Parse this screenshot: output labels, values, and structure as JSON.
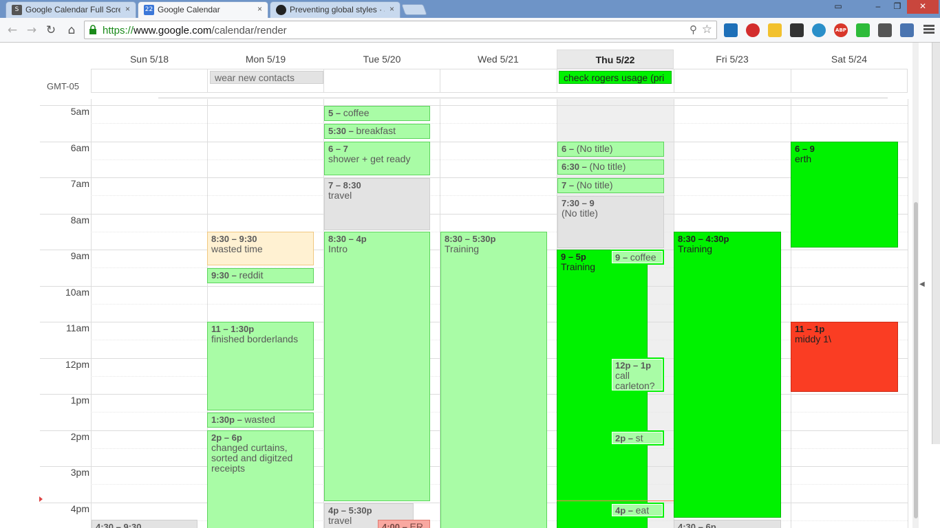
{
  "browser": {
    "tabs": [
      {
        "title": "Google Calendar Full Scre",
        "icon": "s-icon",
        "active": false
      },
      {
        "title": "Google Calendar",
        "icon": "calendar-icon",
        "active": true
      },
      {
        "title": "Preventing global styles · J",
        "icon": "github-icon",
        "active": false
      }
    ],
    "tab_close": "×",
    "calendar_favicon_text": "22",
    "url": {
      "scheme": "https://",
      "domain": "www.google.com",
      "path": "/calendar/render"
    },
    "extensions": [
      "ABP"
    ]
  },
  "calendar": {
    "timezone": "GMT-05",
    "days": [
      "Sun 5/18",
      "Mon 5/19",
      "Tue 5/20",
      "Wed 5/21",
      "Thu 5/22",
      "Fri 5/23",
      "Sat 5/24"
    ],
    "today_index": 4,
    "allday_events": [
      {
        "day": 1,
        "title": "wear new contacts",
        "style": "gray"
      },
      {
        "day": 4,
        "title": "check rogers usage (pri",
        "style": "green"
      }
    ],
    "hours": [
      "5am",
      "6am",
      "7am",
      "8am",
      "9am",
      "10am",
      "11am",
      "12pm",
      "1pm",
      "2pm",
      "3pm",
      "4pm"
    ],
    "events": [
      {
        "time": "5 – ",
        "title": "coffee",
        "inline": true
      },
      {
        "time": "5:30 – ",
        "title": "breakfast",
        "inline": true
      },
      {
        "time": "6 – 7",
        "title": "shower + get ready"
      },
      {
        "time": "7 – 8:30",
        "title": "travel"
      },
      {
        "time": "8:30 – 4p",
        "title": "Intro"
      },
      {
        "time": "4p – 5:30p",
        "title": "travel"
      },
      {
        "time": "4:00 – ",
        "title": "ER"
      },
      {
        "time": "8:30 – 9:30",
        "title": "wasted time"
      },
      {
        "time": "9:30 – ",
        "title": "reddit",
        "inline": true
      },
      {
        "time": "11 – 1:30p",
        "title": "finished borderlands"
      },
      {
        "time": "1:30p – ",
        "title": "wasted",
        "inline": true
      },
      {
        "time": "2p – 6p",
        "title": "changed curtains, sorted and digitzed receipts"
      },
      {
        "time": "8:30 – 5:30p",
        "title": "Training"
      },
      {
        "time": "6 – ",
        "title": "(No title)",
        "inline": true
      },
      {
        "time": "6:30 – ",
        "title": "(No title)",
        "inline": true
      },
      {
        "time": "7 – ",
        "title": "(No title)",
        "inline": true
      },
      {
        "time": "7:30 – 9",
        "title": "(No title)"
      },
      {
        "time": "9 – 5p",
        "title": "Training"
      },
      {
        "time": "9 – ",
        "title": "coffee",
        "inline": true
      },
      {
        "time": "12p – 1p",
        "title": "call carleton?"
      },
      {
        "time": "2p – ",
        "title": "st",
        "inline": true
      },
      {
        "time": "4p – ",
        "title": "eat",
        "inline": true
      },
      {
        "time": "8:30 – 4:30p",
        "title": "Training"
      },
      {
        "time": "4:30 – 6p",
        "title": ""
      },
      {
        "time": "6 – 9",
        "title": "erth"
      },
      {
        "time": "11 – 1p",
        "title": "middy 1\\"
      },
      {
        "time": "4:30 – 9:30",
        "title": ""
      }
    ]
  }
}
